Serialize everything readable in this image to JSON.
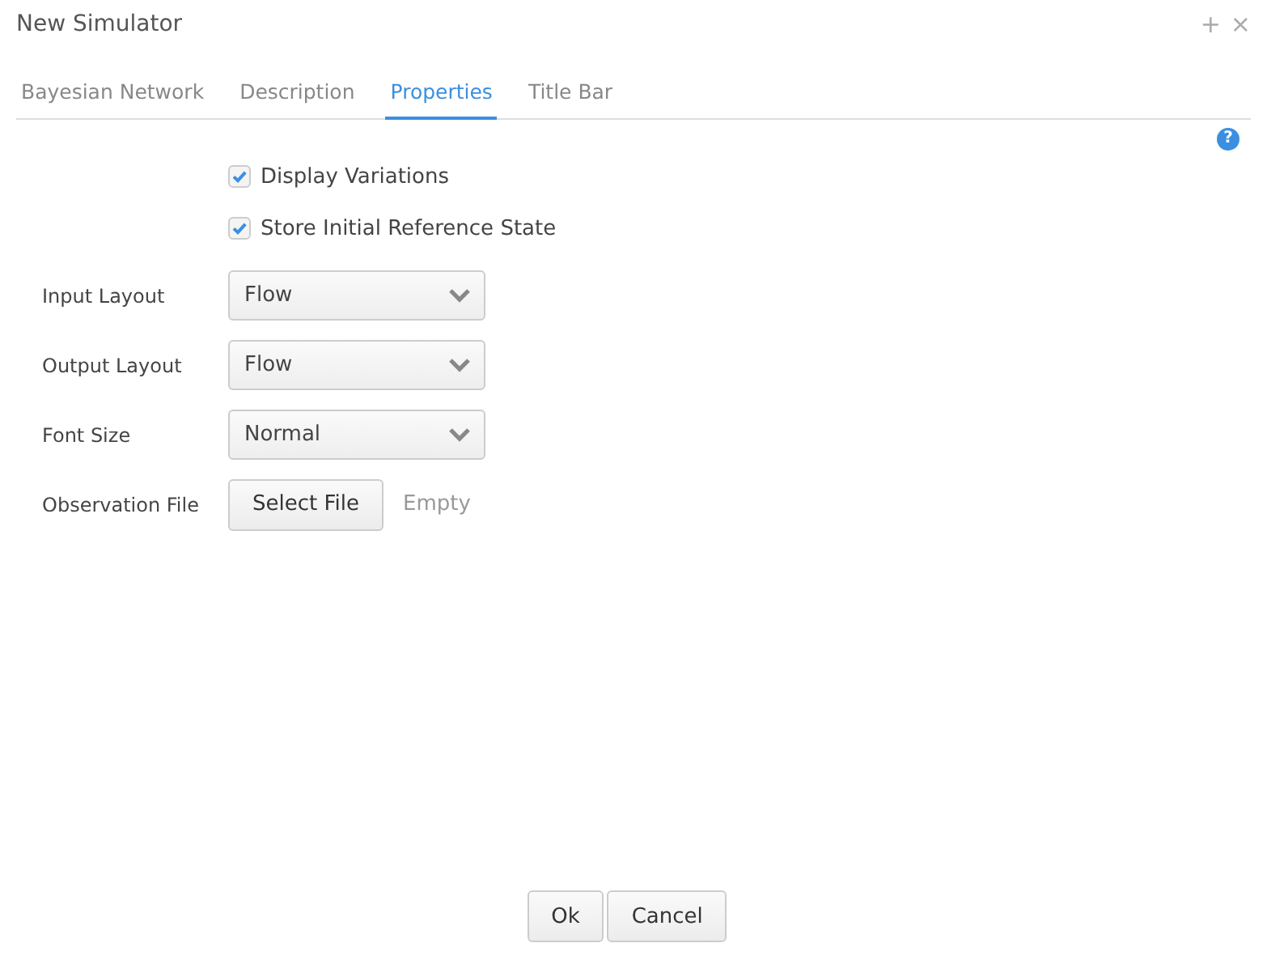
{
  "window": {
    "title": "New Simulator",
    "actions": [
      "+",
      "×"
    ]
  },
  "tabs": [
    {
      "label": "Bayesian Network",
      "selected": false
    },
    {
      "label": "Description",
      "selected": false
    },
    {
      "label": "Properties",
      "selected": true
    },
    {
      "label": "Title Bar",
      "selected": false
    }
  ],
  "help": "?",
  "checkboxes": [
    {
      "label": "Display Variations",
      "checked": true
    },
    {
      "label": "Store Initial Reference State",
      "checked": true
    }
  ],
  "fields": [
    {
      "kind": "select",
      "label": "Input Layout",
      "value": "Flow"
    },
    {
      "kind": "select",
      "label": "Output Layout",
      "value": "Flow"
    },
    {
      "kind": "select",
      "label": "Font Size",
      "value": "Normal"
    },
    {
      "kind": "file",
      "label": "Observation File",
      "button": "Select File",
      "value": "Empty"
    }
  ],
  "buttons": [
    "Ok",
    "Cancel"
  ]
}
